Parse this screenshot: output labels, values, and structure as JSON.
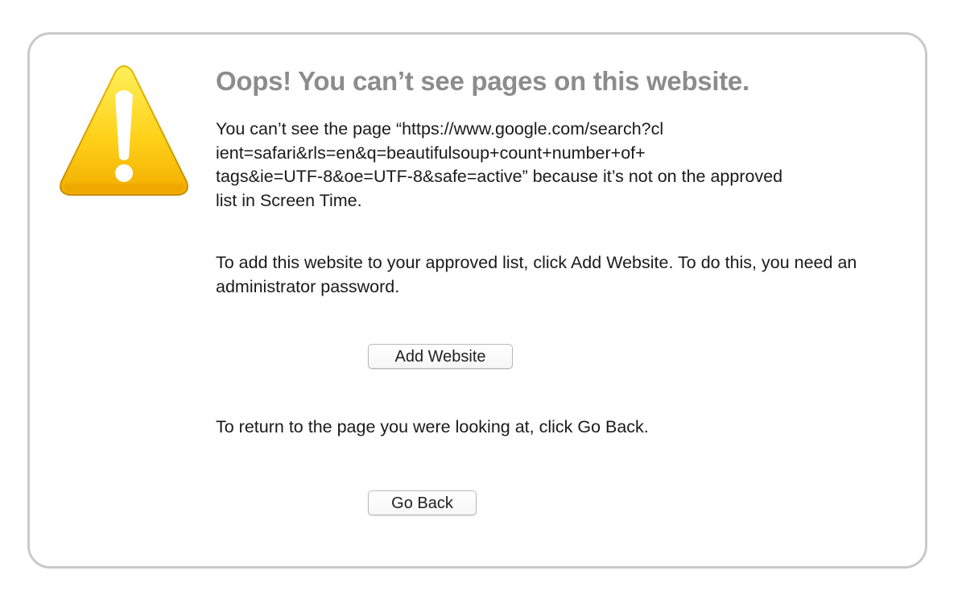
{
  "title": "Oops! You can’t see pages on this website.",
  "message": {
    "line1_prefix": "You can’t see the page “https://www.google.com/search?cl",
    "line2": "ient=safari&rls=en&q=beautifulsoup+count+number+of+",
    "line3_suffix": "tags&ie=UTF-8&oe=UTF-8&safe=active” because it’s not on the approved",
    "line4": "list in Screen Time."
  },
  "instructions": {
    "add_text": "To add this website to your approved list, click Add Website. To do this, you need an administrator password.",
    "back_text": "To return to the page you were looking at, click Go Back."
  },
  "buttons": {
    "add_website": "Add Website",
    "go_back": "Go Back"
  },
  "colors": {
    "title": "#8c8c8c",
    "warning_fill_top": "#ffe033",
    "warning_fill_bottom": "#f5b800",
    "border": "#c9c9c9"
  },
  "icons": {
    "warning": "warning-triangle-icon"
  }
}
